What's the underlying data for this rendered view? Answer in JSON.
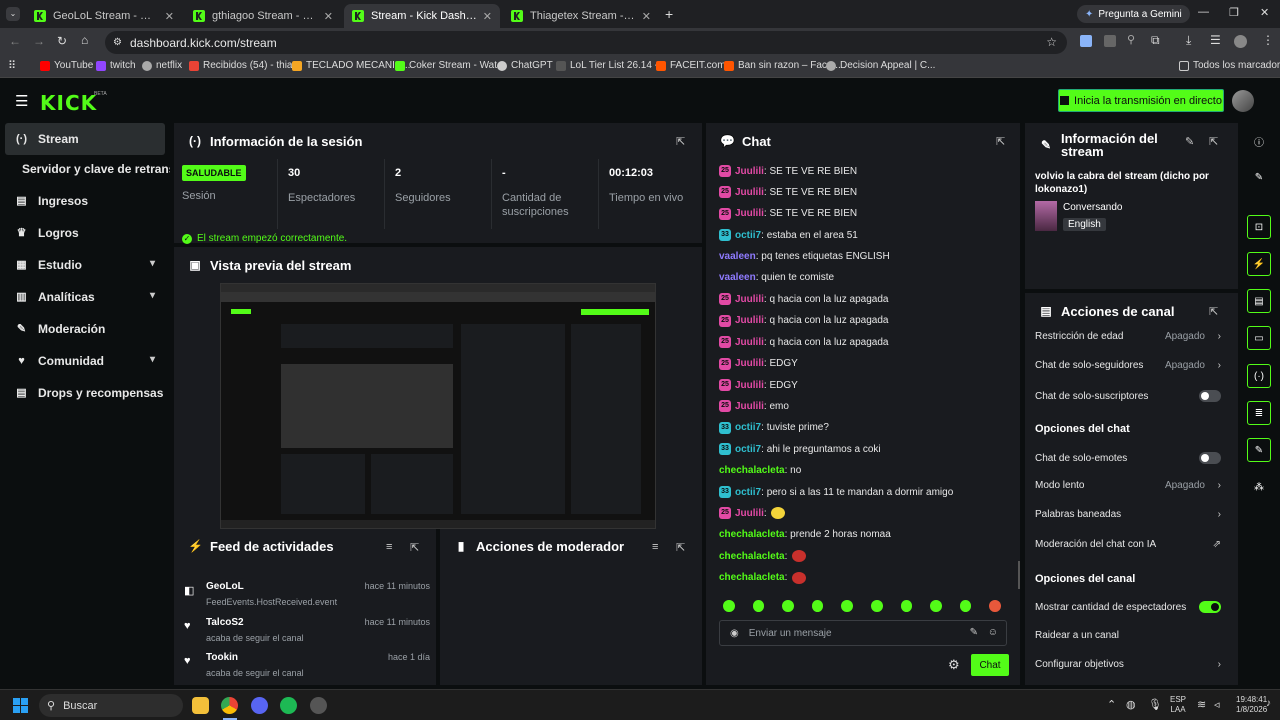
{
  "browser": {
    "tabs": [
      {
        "label": "GeoLoL Stream - Watch Live on",
        "active": false
      },
      {
        "label": "gthiagoo Stream - Watch Live o",
        "active": false
      },
      {
        "label": "Stream - Kick Dashboard",
        "active": true
      },
      {
        "label": "Thiagetex Stream - Watch Live",
        "active": false
      }
    ],
    "gemini_label": "Pregunta a Gemini",
    "url": "dashboard.kick.com/stream",
    "bookmarks": [
      "YouTube",
      "twitch",
      "netflix",
      "Recibidos (54) - thia...",
      "TECLADO MECANIC...",
      "Coker Stream - Wat...",
      "ChatGPT",
      "LoL Tier List 26.14 -...",
      "FACEIT.com",
      "Ban sin razon – Face...",
      "Decision Appeal | C..."
    ],
    "all_bookmarks": "Todos los marcadores"
  },
  "app": {
    "logo": "KICK",
    "beta": "BETA",
    "go_live": "Inicia la transmisión en directo"
  },
  "sidebar": {
    "items": [
      {
        "label": "Stream",
        "icon": "stream-icon"
      },
      {
        "label": "Servidor y clave de retransmi",
        "icon": ""
      },
      {
        "label": "Ingresos",
        "icon": "revenue-icon"
      },
      {
        "label": "Logros",
        "icon": "trophy-icon"
      },
      {
        "label": "Estudio",
        "icon": "studio-icon"
      },
      {
        "label": "Analíticas",
        "icon": "analytics-icon"
      },
      {
        "label": "Moderación",
        "icon": "wrench-icon"
      },
      {
        "label": "Comunidad",
        "icon": "community-icon"
      },
      {
        "label": "Drops y recompensas",
        "icon": "drops-icon"
      }
    ]
  },
  "session": {
    "title": "Información de la sesión",
    "status_badge": "SALUDABLE",
    "status_label": "Sesión",
    "stats": [
      {
        "value": "30",
        "label": "Espectadores"
      },
      {
        "value": "2",
        "label": "Seguidores"
      },
      {
        "value": "-",
        "label": "Cantidad de suscripciones"
      },
      {
        "value": "00:12:03",
        "label": "Tiempo en vivo"
      }
    ],
    "started_message": "El stream empezó correctamente."
  },
  "preview": {
    "title": "Vista previa del stream"
  },
  "chat": {
    "title": "Chat",
    "messages": [
      {
        "user": "Juulili",
        "text": "SE TE VE RE BIEN",
        "color": "#e24aa5",
        "badge": "25"
      },
      {
        "user": "Juulili",
        "text": "SE TE VE RE BIEN",
        "color": "#e24aa5",
        "badge": "25"
      },
      {
        "user": "Juulili",
        "text": "SE TE VE RE BIEN",
        "color": "#e24aa5",
        "badge": "25"
      },
      {
        "user": "octii7",
        "text": "estaba en el area 51",
        "color": "#2fbfcf",
        "badge": "33"
      },
      {
        "user": "vaaleen",
        "text": "pq tenes etiquetas ENGLISH",
        "color": "#8f7bff",
        "badge": ""
      },
      {
        "user": "vaaleen",
        "text": "quien te comiste",
        "color": "#8f7bff",
        "badge": ""
      },
      {
        "user": "Juulili",
        "text": "q hacia con la luz apagada",
        "color": "#e24aa5",
        "badge": "25"
      },
      {
        "user": "Juulili",
        "text": "q hacia con la luz apagada",
        "color": "#e24aa5",
        "badge": "25"
      },
      {
        "user": "Juulili",
        "text": "q hacia con la luz apagada",
        "color": "#e24aa5",
        "badge": "25"
      },
      {
        "user": "Juulili",
        "text": "EDGY",
        "color": "#e24aa5",
        "badge": "25"
      },
      {
        "user": "Juulili",
        "text": "EDGY",
        "color": "#e24aa5",
        "badge": "25"
      },
      {
        "user": "Juulili",
        "text": "emo",
        "color": "#e24aa5",
        "badge": "25"
      },
      {
        "user": "octii7",
        "text": "tuviste prime?",
        "color": "#2fbfcf",
        "badge": "33"
      },
      {
        "user": "octii7",
        "text": "ahi le preguntamos a coki",
        "color": "#2fbfcf",
        "badge": "33"
      },
      {
        "user": "chechalacleta",
        "text": "no",
        "color": "#53fc18",
        "badge": ""
      },
      {
        "user": "octii7",
        "text": "pero si a las 11 te mandan a dormir amigo",
        "color": "#2fbfcf",
        "badge": "33"
      },
      {
        "user": "Juulili",
        "text": "",
        "color": "#e24aa5",
        "badge": "25"
      },
      {
        "user": "chechalacleta",
        "text": "prende 2 horas nomaa",
        "color": "#53fc18",
        "badge": ""
      },
      {
        "user": "chechalacleta",
        "text": "",
        "color": "#53fc18",
        "badge": ""
      },
      {
        "user": "chechalacleta",
        "text": "",
        "color": "#53fc18",
        "badge": ""
      }
    ],
    "input_placeholder": "Enviar un mensaje",
    "send_label": "Chat"
  },
  "stream_info": {
    "title": "Información del stream",
    "stream_title": "volvio la cabra del stream (dicho por lokonazo1)",
    "category": "Conversando",
    "language": "English"
  },
  "channel_actions": {
    "title": "Acciones de canal",
    "items": [
      {
        "label": "Restricción de edad",
        "value": "Apagado",
        "type": "chevron"
      },
      {
        "label": "Chat de solo-seguidores",
        "value": "Apagado",
        "type": "chevron"
      },
      {
        "label": "Chat de solo-suscriptores",
        "value": "",
        "type": "toggle-off"
      }
    ],
    "chat_options_title": "Opciones del chat",
    "chat_options": [
      {
        "label": "Chat de solo-emotes",
        "value": "",
        "type": "toggle-off"
      },
      {
        "label": "Modo lento",
        "value": "Apagado",
        "type": "chevron"
      },
      {
        "label": "Palabras baneadas",
        "value": "",
        "type": "chevron"
      },
      {
        "label": "Moderación del chat con IA",
        "value": "",
        "type": "external"
      }
    ],
    "channel_options_title": "Opciones del canal",
    "channel_options": [
      {
        "label": "Mostrar cantidad de espectadores",
        "value": "",
        "type": "toggle-on"
      },
      {
        "label": "Raidear a un canal",
        "value": "",
        "type": "none"
      },
      {
        "label": "Configurar objetivos",
        "value": "",
        "type": "chevron"
      }
    ]
  },
  "activity_feed": {
    "title": "Feed de actividades",
    "items": [
      {
        "name": "GeoLoL",
        "sub": "FeedEvents.HostReceived.event",
        "time": "hace 11 minutos"
      },
      {
        "name": "TalcoS2",
        "sub": "acaba de seguir el canal",
        "time": "hace 11 minutos"
      },
      {
        "name": "Tookin",
        "sub": "acaba de seguir el canal",
        "time": "hace 1 día"
      }
    ]
  },
  "mod_actions": {
    "title": "Acciones de moderador"
  },
  "taskbar": {
    "search": "Buscar",
    "lang": "ESP",
    "lang2": "LAA",
    "time": "19:48:41",
    "date": "1/8/2026"
  },
  "colors": {
    "accent": "#53fc18",
    "bg": "#0b0e0f",
    "panel": "#191b1f"
  }
}
